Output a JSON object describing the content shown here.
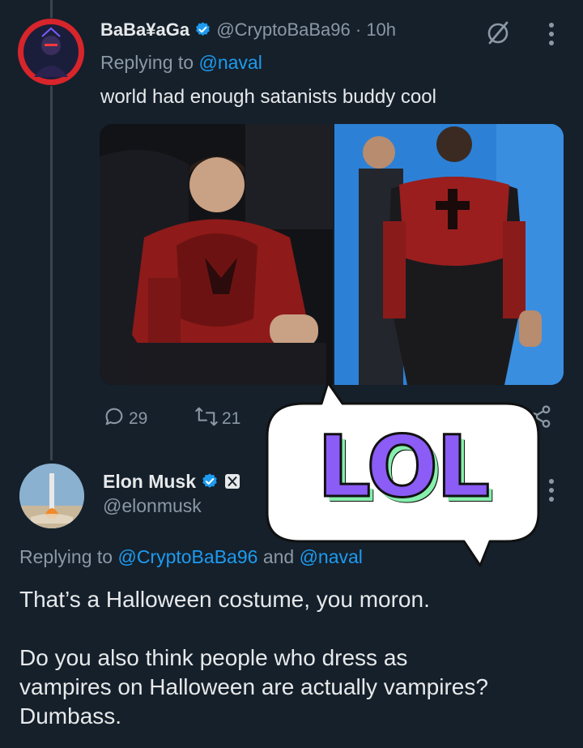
{
  "tweet1": {
    "display_name": "BaBa¥aGa",
    "handle": "@CryptoBaBa96",
    "time": "· 10h",
    "replying_prefix": "Replying to",
    "replying_to": "@naval",
    "text": "world had enough satanists buddy cool",
    "replies": "29",
    "reposts": "21"
  },
  "tweet2": {
    "display_name": "Elon Musk",
    "handle": "@elonmusk",
    "replying_prefix": "Replying to",
    "replying_to_1": "@CryptoBaBa96",
    "replying_and": "and",
    "replying_to_2": "@naval",
    "text_line1": "That’s a Halloween costume, you moron.",
    "text_line2": "Do you also think people who dress as",
    "text_line3": "vampires on Halloween are actually vampires?",
    "text_line4": "Dumbass."
  },
  "sticker": {
    "text": "LOL"
  },
  "colors": {
    "background": "#15202b",
    "accent": "#1d9bf0",
    "muted": "#8b98a5",
    "sticker_letters": "#8b5cf6",
    "sticker_shadow": "#86efac"
  }
}
